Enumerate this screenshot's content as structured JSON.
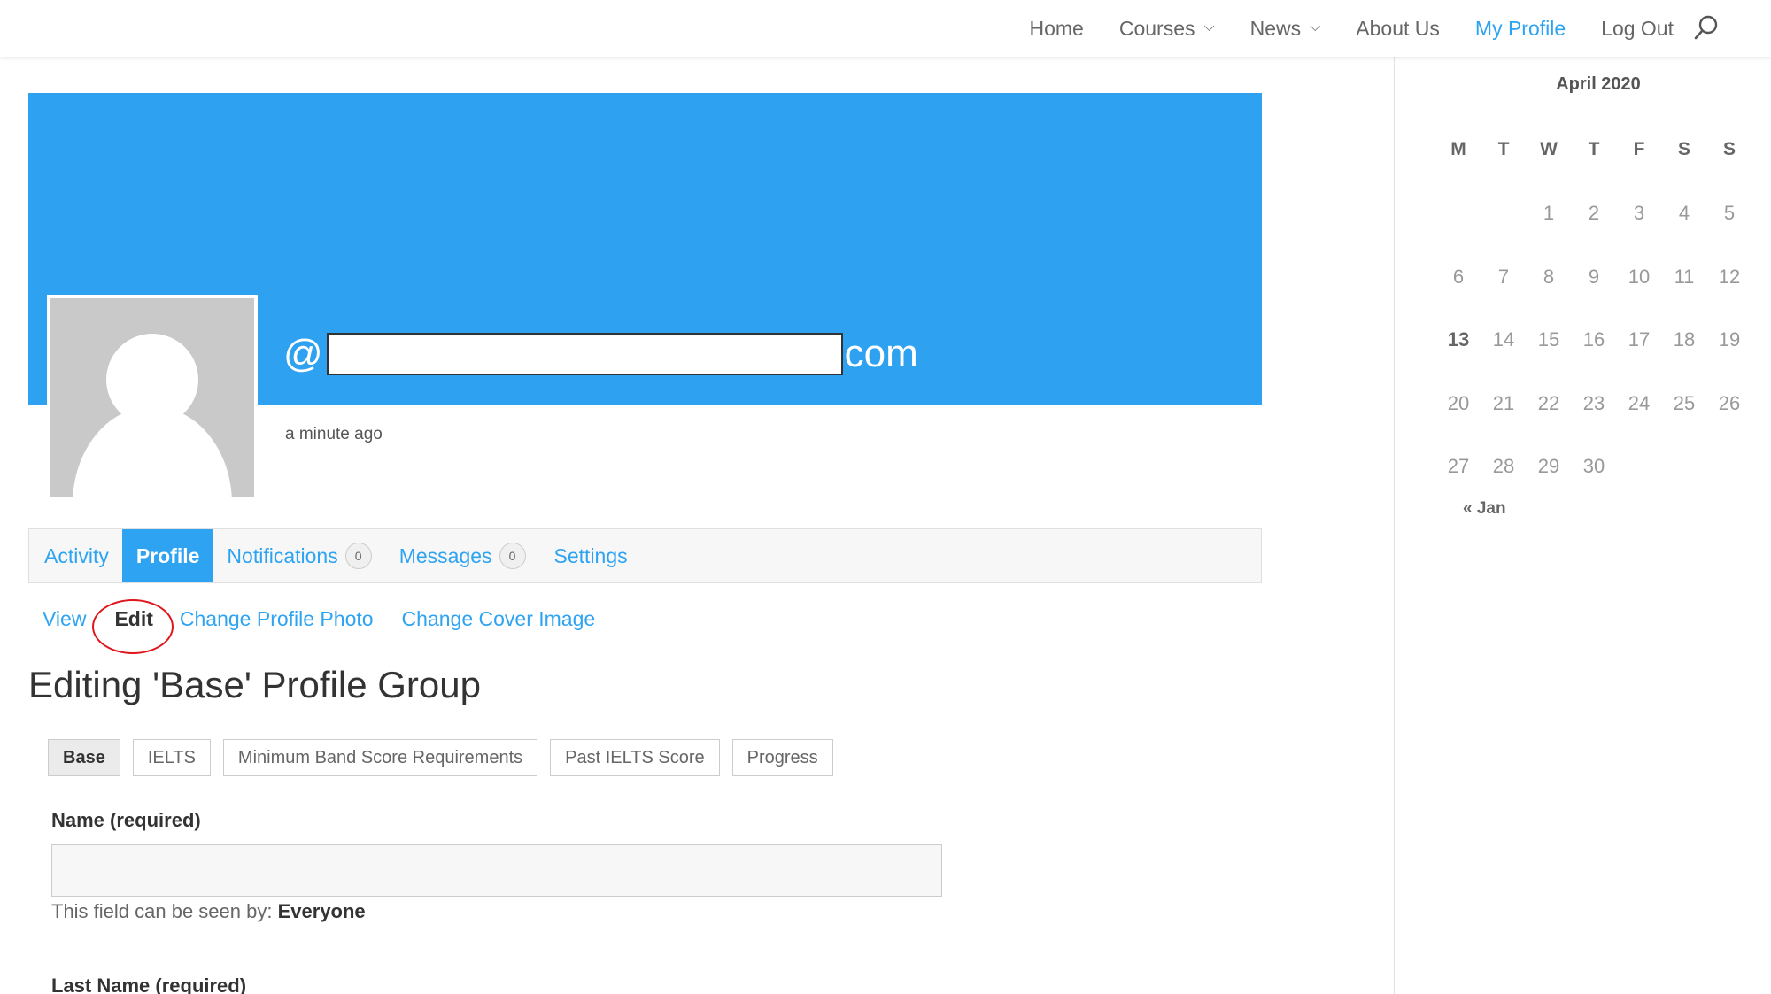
{
  "nav": {
    "items": [
      {
        "label": "Home",
        "has_dropdown": false,
        "active": false
      },
      {
        "label": "Courses",
        "has_dropdown": true,
        "active": false
      },
      {
        "label": "News",
        "has_dropdown": true,
        "active": false
      },
      {
        "label": "About Us",
        "has_dropdown": false,
        "active": false
      },
      {
        "label": "My Profile",
        "has_dropdown": false,
        "active": true
      },
      {
        "label": "Log Out",
        "has_dropdown": false,
        "active": false
      }
    ],
    "search_icon": "search-icon",
    "accent_color": "#2ea3f2"
  },
  "profile": {
    "handle_prefix": "@",
    "handle_suffix": "com",
    "last_active": "a minute ago",
    "cover_color": "#2ea2f0"
  },
  "tabs": [
    {
      "label": "Activity",
      "count": null,
      "active": false
    },
    {
      "label": "Profile",
      "count": null,
      "active": true
    },
    {
      "label": "Notifications",
      "count": "0",
      "active": false
    },
    {
      "label": "Messages",
      "count": "0",
      "active": false
    },
    {
      "label": "Settings",
      "count": null,
      "active": false
    }
  ],
  "subnav": [
    {
      "label": "View",
      "current": false
    },
    {
      "label": "Edit",
      "current": true
    },
    {
      "label": "Change Profile Photo",
      "current": false
    },
    {
      "label": "Change Cover Image",
      "current": false
    }
  ],
  "heading": "Editing 'Base' Profile Group",
  "groups": [
    {
      "label": "Base",
      "active": true
    },
    {
      "label": "IELTS",
      "active": false
    },
    {
      "label": "Minimum Band Score Requirements",
      "active": false
    },
    {
      "label": "Past IELTS Score",
      "active": false
    },
    {
      "label": "Progress",
      "active": false
    }
  ],
  "form": {
    "name_label": "Name (required)",
    "name_value": "",
    "visibility_prefix": "This field can be seen by:",
    "visibility_value": "Everyone",
    "last_name_label": "Last Name (required)"
  },
  "calendar": {
    "title": "April 2020",
    "weekdays": [
      "M",
      "T",
      "W",
      "T",
      "F",
      "S",
      "S"
    ],
    "weeks": [
      [
        "",
        "",
        "1",
        "2",
        "3",
        "4",
        "5"
      ],
      [
        "6",
        "7",
        "8",
        "9",
        "10",
        "11",
        "12"
      ],
      [
        "13",
        "14",
        "15",
        "16",
        "17",
        "18",
        "19"
      ],
      [
        "20",
        "21",
        "22",
        "23",
        "24",
        "25",
        "26"
      ],
      [
        "27",
        "28",
        "29",
        "30",
        "",
        "",
        ""
      ]
    ],
    "today": "13",
    "prev_label": "« Jan"
  }
}
